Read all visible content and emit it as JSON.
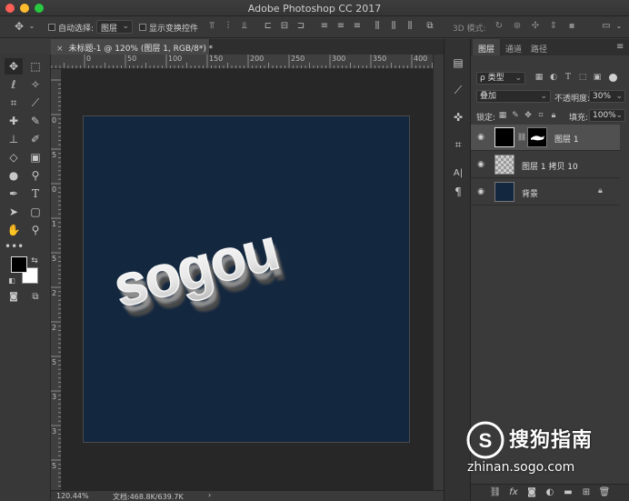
{
  "window": {
    "title": "Adobe Photoshop CC 2017"
  },
  "options_bar": {
    "auto_select_label": "自动选择:",
    "auto_select_target": "图层",
    "show_transform_label": "显示变换控件",
    "mode_3d_label": "3D 模式:"
  },
  "document": {
    "tab_title": "未标题-1 @ 120% (图层 1, RGB/8*) *",
    "zoom": "120.44%",
    "doc_size": "文档:468.8K/639.7K",
    "ruler_top": [
      "0",
      "50",
      "100",
      "150",
      "200",
      "250",
      "300",
      "350",
      "400"
    ],
    "ruler_left": [
      "0",
      "5",
      "0",
      "1",
      "5",
      "2",
      "2",
      "5",
      "3",
      "3",
      "5",
      "4"
    ],
    "canvas_text": "sogou"
  },
  "layers_panel": {
    "tabs": [
      "图层",
      "通道",
      "路径"
    ],
    "active_tab": "图层",
    "filter_label": "ρ 类型",
    "blend_mode": "叠加",
    "opacity_label": "不透明度:",
    "opacity_value": "30%",
    "lock_label": "锁定:",
    "fill_label": "填充:",
    "fill_value": "100%",
    "layers": [
      {
        "name": "图层 1",
        "selected": true,
        "has_mask": true
      },
      {
        "name": "图层 1 拷贝 10",
        "selected": false,
        "has_mask": false
      },
      {
        "name": "背景",
        "selected": false,
        "locked": true
      }
    ],
    "bottom_fx_label": "fx"
  },
  "watermark": {
    "logo_text": "搜狗指南",
    "url": "zhinan.sogo.com"
  },
  "colors": {
    "canvas_bg": "#13273f",
    "foreground": "#000000",
    "background": "#ffffff",
    "close_btn": "#fe5f57",
    "min_btn": "#febc2e",
    "max_btn": "#28c840"
  }
}
